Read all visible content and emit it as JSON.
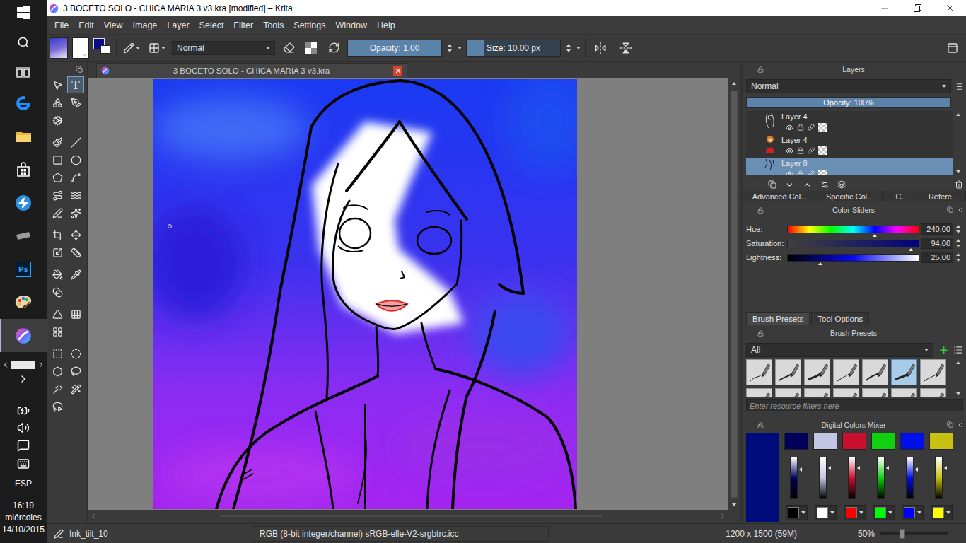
{
  "window": {
    "title": "3 BOCETO SOLO - CHICA MARIA 3 v3.kra [modified] – Krita"
  },
  "menu": [
    "File",
    "Edit",
    "View",
    "Image",
    "Layer",
    "Select",
    "Filter",
    "Tools",
    "Settings",
    "Window",
    "Help"
  ],
  "toolbar": {
    "foreground": "#0c0c8a",
    "background": "#ffffff",
    "blend_mode": "Normal",
    "opacity": {
      "text": "Opacity:  1.00",
      "level": 1
    },
    "size": {
      "text": "Size:  10.00 px",
      "level": 0.18
    }
  },
  "toolbox": [
    {
      "selected": false
    },
    {
      "selected": true,
      "glyph": "T"
    },
    {
      "selected": false
    },
    {
      "selected": false
    },
    {
      "selected": false
    },
    {
      "selected": false
    },
    {
      "selected": false
    },
    {
      "selected": false
    },
    {
      "selected": false
    },
    {
      "selected": false
    },
    {
      "selected": false
    },
    {
      "selected": false
    },
    {
      "selected": false
    },
    {
      "selected": false
    },
    {
      "selected": false
    },
    {
      "selected": false
    },
    {
      "selected": false
    },
    {
      "selected": false
    },
    {
      "selected": false
    },
    {
      "selected": false
    },
    {
      "selected": false
    },
    {
      "selected": false
    },
    {
      "selected": false
    },
    {
      "selected": false
    },
    {
      "selected": false
    },
    {
      "selected": false
    },
    {
      "selected": false
    },
    {
      "selected": false
    },
    {
      "selected": false
    },
    {
      "selected": false
    },
    {
      "selected": false
    },
    {
      "selected": false
    }
  ],
  "document_tab": {
    "title": "3 BOCETO SOLO - CHICA MARIA 3 v3.kra"
  },
  "layers": {
    "title": "Layers",
    "blend_mode": "Normal",
    "opacity": "Opacity:  100%",
    "opacity_level": 1,
    "items": [
      {
        "name": "Layer 4",
        "selected": false,
        "visible": true,
        "kind": "sketch"
      },
      {
        "name": "Layer 4",
        "selected": false,
        "visible": true,
        "kind": "figure"
      },
      {
        "name": "Layer 8",
        "selected": true,
        "visible": true,
        "kind": "lines"
      }
    ]
  },
  "docker_tabs": [
    {
      "label": "Advanced Col...",
      "selected": false
    },
    {
      "label": "Specific Col...",
      "selected": false
    },
    {
      "label": "C...",
      "selected": false
    },
    {
      "label": "Refere...",
      "selected": false
    }
  ],
  "color_sliders": {
    "title": "Color Sliders",
    "sliders": [
      {
        "label": "Hue:",
        "value": "240,00",
        "level": 0.667,
        "kind": "hue"
      },
      {
        "label": "Saturation:",
        "value": "94,00",
        "level": 0.94,
        "kind": "saturation"
      },
      {
        "label": "Lightness:",
        "value": "25,00",
        "level": 0.25,
        "kind": "lightness"
      }
    ]
  },
  "brush_tabs": [
    {
      "label": "Brush Presets",
      "selected": true
    },
    {
      "label": "Tool Options",
      "selected": false
    }
  ],
  "brush_presets": {
    "title": "Brush Presets",
    "filter": "All",
    "search_placeholder": "Enter resource filters here",
    "presets": [
      {
        "selected": false
      },
      {
        "selected": false
      },
      {
        "selected": false
      },
      {
        "selected": false
      },
      {
        "selected": false
      },
      {
        "selected": true
      },
      {
        "selected": false
      },
      {
        "selected": false
      },
      {
        "selected": false
      },
      {
        "selected": false
      },
      {
        "selected": false
      },
      {
        "selected": false
      },
      {
        "selected": false
      },
      {
        "selected": false
      }
    ]
  },
  "color_mixer": {
    "title": "Digital Colors Mixer",
    "current": "#000c7c",
    "channels": [
      {
        "color": "#00005a",
        "level": 0.7
      },
      {
        "color": "#c4c4e4",
        "level": 0.74
      },
      {
        "color": "#c8102e",
        "level": 0.74
      },
      {
        "color": "#10d010",
        "level": 0.74
      },
      {
        "color": "#0010e8",
        "level": 0.7
      },
      {
        "color": "#c8c012",
        "level": 0.74
      }
    ],
    "presets": [
      {
        "color": "#000000"
      },
      {
        "color": "#ffffff"
      },
      {
        "color": "#ff0000"
      },
      {
        "color": "#00ff00"
      },
      {
        "color": "#0000ff"
      },
      {
        "color": "#ffff00"
      }
    ]
  },
  "status_bar": {
    "brush": "Ink_tilt_10",
    "color_space": "RGB (8-bit integer/channel)  sRGB-elle-V2-srgbtrc.icc",
    "dimensions": "1200 x 1500 (59M)",
    "zoom": "50%",
    "zoom_level": 0.32
  },
  "taskbar": {
    "apps": [
      {
        "kind": "start",
        "active": false
      },
      {
        "kind": "search",
        "active": false
      },
      {
        "kind": "taskview",
        "active": false
      },
      {
        "kind": "edge",
        "active": false
      },
      {
        "kind": "explorer",
        "active": false
      },
      {
        "kind": "store",
        "active": false
      },
      {
        "kind": "app-blue",
        "active": false
      },
      {
        "kind": "app-gray",
        "active": false
      },
      {
        "kind": "photoshop",
        "glyph": "Ps",
        "active": false
      },
      {
        "kind": "palette",
        "active": false
      },
      {
        "kind": "krita",
        "active": true
      }
    ],
    "language": "ESP",
    "time": "16:19",
    "day": "miércoles",
    "date": "14/10/2015"
  }
}
